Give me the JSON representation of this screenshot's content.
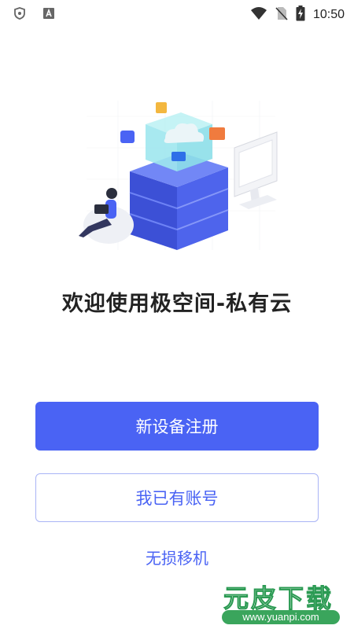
{
  "status_bar": {
    "time": "10:50",
    "left_icons": [
      "shield-icon",
      "a-icon"
    ],
    "right_icons": [
      "wifi-icon",
      "no-sim-icon",
      "battery-charging-icon"
    ]
  },
  "main": {
    "welcome_title": "欢迎使用极空间-私有云",
    "register_button": "新设备注册",
    "login_button": "我已有账号",
    "migrate_link": "无损移机"
  },
  "watermark": {
    "brand": "元皮下载",
    "url": "www.yuanpi.com"
  },
  "colors": {
    "primary": "#4a63f4",
    "primary_border": "#a9b4f6",
    "title_text": "#222222",
    "watermark_green": "#3aa55c"
  }
}
